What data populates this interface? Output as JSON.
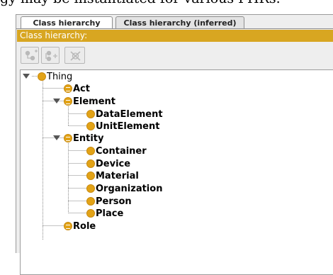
{
  "top_text": "gy may be instantiated for various PHRs.",
  "tabs": [
    {
      "label": "Class hierarchy",
      "active": true
    },
    {
      "label": "Class hierarchy (inferred)",
      "active": false
    }
  ],
  "header": {
    "title": "Class hierarchy:",
    "color": "#d8a621"
  },
  "toolbar": [
    {
      "icon": "add-subclass-icon"
    },
    {
      "icon": "add-sibling-class-icon"
    },
    {
      "icon": "delete-class-icon"
    }
  ],
  "tree": {
    "root": "Thing",
    "nodes": [
      {
        "label": "Act"
      },
      {
        "label": "Element",
        "children": [
          "DataElement",
          "UnitElement"
        ]
      },
      {
        "label": "Entity",
        "children": [
          "Container",
          "Device",
          "Material",
          "Organization",
          "Person",
          "Place"
        ]
      },
      {
        "label": "Role"
      }
    ]
  }
}
